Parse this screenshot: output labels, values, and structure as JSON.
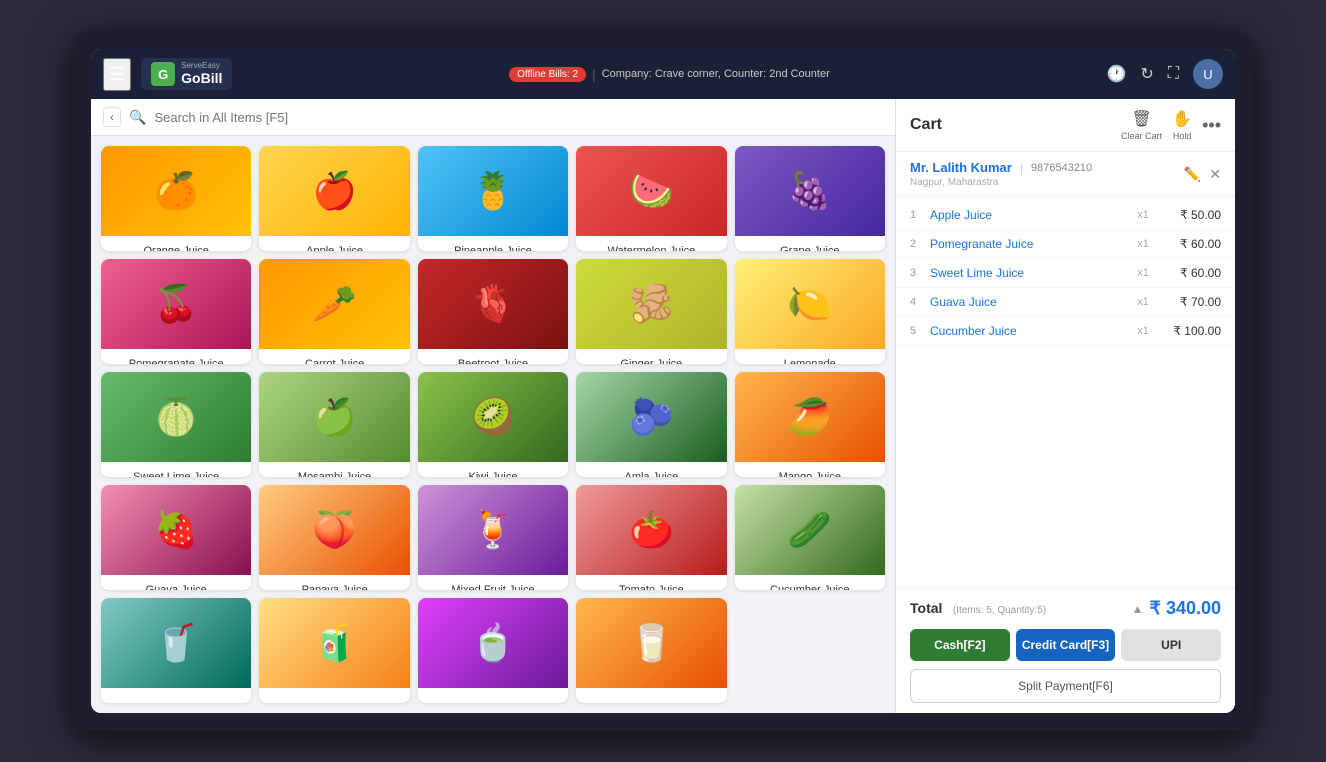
{
  "header": {
    "hamburger_label": "☰",
    "logo_sub": "ServeEasy",
    "logo_main": "GoBill",
    "logo_icon": "G",
    "offline_label": "Offline Bills: 2",
    "company_info": "Company: Crave corner,  Counter: 2nd Counter",
    "icon_history": "🕐",
    "icon_refresh": "↻",
    "icon_fullscreen": "⛶",
    "avatar_label": "U"
  },
  "search": {
    "placeholder": "Search in All Items [F5]"
  },
  "products": [
    {
      "id": 1,
      "name": "Orange Juice",
      "emoji": "🍊",
      "color_class": "juice-orange"
    },
    {
      "id": 2,
      "name": "Apple Juice",
      "emoji": "🍎",
      "color_class": "juice-yellow"
    },
    {
      "id": 3,
      "name": "Pineapple Juice",
      "emoji": "🍍",
      "color_class": "juice-blue"
    },
    {
      "id": 4,
      "name": "Watermelon Juice",
      "emoji": "🍉",
      "color_class": "juice-red"
    },
    {
      "id": 5,
      "name": "Grape Juice",
      "emoji": "🍇",
      "color_class": "juice-purple"
    },
    {
      "id": 6,
      "name": "Pomegranate Juice",
      "emoji": "🍒",
      "color_class": "juice-pink"
    },
    {
      "id": 7,
      "name": "Carrot Juice",
      "emoji": "🥕",
      "color_class": "juice-orange"
    },
    {
      "id": 8,
      "name": "Beetroot Juice",
      "emoji": "🫀",
      "color_class": "juice-darkred"
    },
    {
      "id": 9,
      "name": "Ginger Juice",
      "emoji": "🫚",
      "color_class": "juice-ginger"
    },
    {
      "id": 10,
      "name": "Lemonade",
      "emoji": "🍋",
      "color_class": "juice-lemon"
    },
    {
      "id": 11,
      "name": "Sweet Lime Juice",
      "emoji": "🍈",
      "color_class": "juice-green"
    },
    {
      "id": 12,
      "name": "Mosambi Juice",
      "emoji": "🍏",
      "color_class": "juice-mosambi"
    },
    {
      "id": 13,
      "name": "Kiwi Juice",
      "emoji": "🥝",
      "color_class": "juice-kiwi"
    },
    {
      "id": 14,
      "name": "Amla Juice",
      "emoji": "🫐",
      "color_class": "juice-amla"
    },
    {
      "id": 15,
      "name": "Mango Juice",
      "emoji": "🥭",
      "color_class": "juice-mango"
    },
    {
      "id": 16,
      "name": "Guava Juice",
      "emoji": "🍓",
      "color_class": "juice-guava"
    },
    {
      "id": 17,
      "name": "Papaya Juice",
      "emoji": "🍑",
      "color_class": "juice-papaya"
    },
    {
      "id": 18,
      "name": "Mixed Fruit Juice",
      "emoji": "🍹",
      "color_class": "juice-mixed"
    },
    {
      "id": 19,
      "name": "Tomato Juice",
      "emoji": "🍅",
      "color_class": "juice-tomato"
    },
    {
      "id": 20,
      "name": "Cucumber Juice",
      "emoji": "🥒",
      "color_class": "juice-cucumber"
    },
    {
      "id": 21,
      "name": "",
      "emoji": "🥤",
      "color_class": "juice-bottom1"
    },
    {
      "id": 22,
      "name": "",
      "emoji": "🧃",
      "color_class": "juice-bottom2"
    },
    {
      "id": 23,
      "name": "",
      "emoji": "🍵",
      "color_class": "juice-bottom3"
    },
    {
      "id": 24,
      "name": "",
      "emoji": "🥛",
      "color_class": "juice-mango"
    }
  ],
  "cart": {
    "title": "Cart",
    "clear_cart_label": "Clear Cart",
    "hold_label": "Hold",
    "more_icon": "•••",
    "customer": {
      "name": "Mr. Lalith Kumar",
      "phone": "9876543210",
      "location": "Nagpur, Maharastra"
    },
    "items": [
      {
        "num": "1",
        "name": "Apple Juice",
        "qty": "x1",
        "price": "₹ 50.00"
      },
      {
        "num": "2",
        "name": "Pomegranate Juice",
        "qty": "x1",
        "price": "₹ 60.00"
      },
      {
        "num": "3",
        "name": "Sweet Lime Juice",
        "qty": "x1",
        "price": "₹ 60.00"
      },
      {
        "num": "4",
        "name": "Guava Juice",
        "qty": "x1",
        "price": "₹ 70.00"
      },
      {
        "num": "5",
        "name": "Cucumber Juice",
        "qty": "x1",
        "price": "₹ 100.00"
      }
    ],
    "total_label": "Total",
    "total_meta": "(Items: 5, Quantity:5)",
    "total_amount": "₹ 340.00",
    "btn_cash": "Cash[F2]",
    "btn_card": "Credit Card[F3]",
    "btn_upi": "UPI",
    "btn_split": "Split Payment[F6]"
  }
}
